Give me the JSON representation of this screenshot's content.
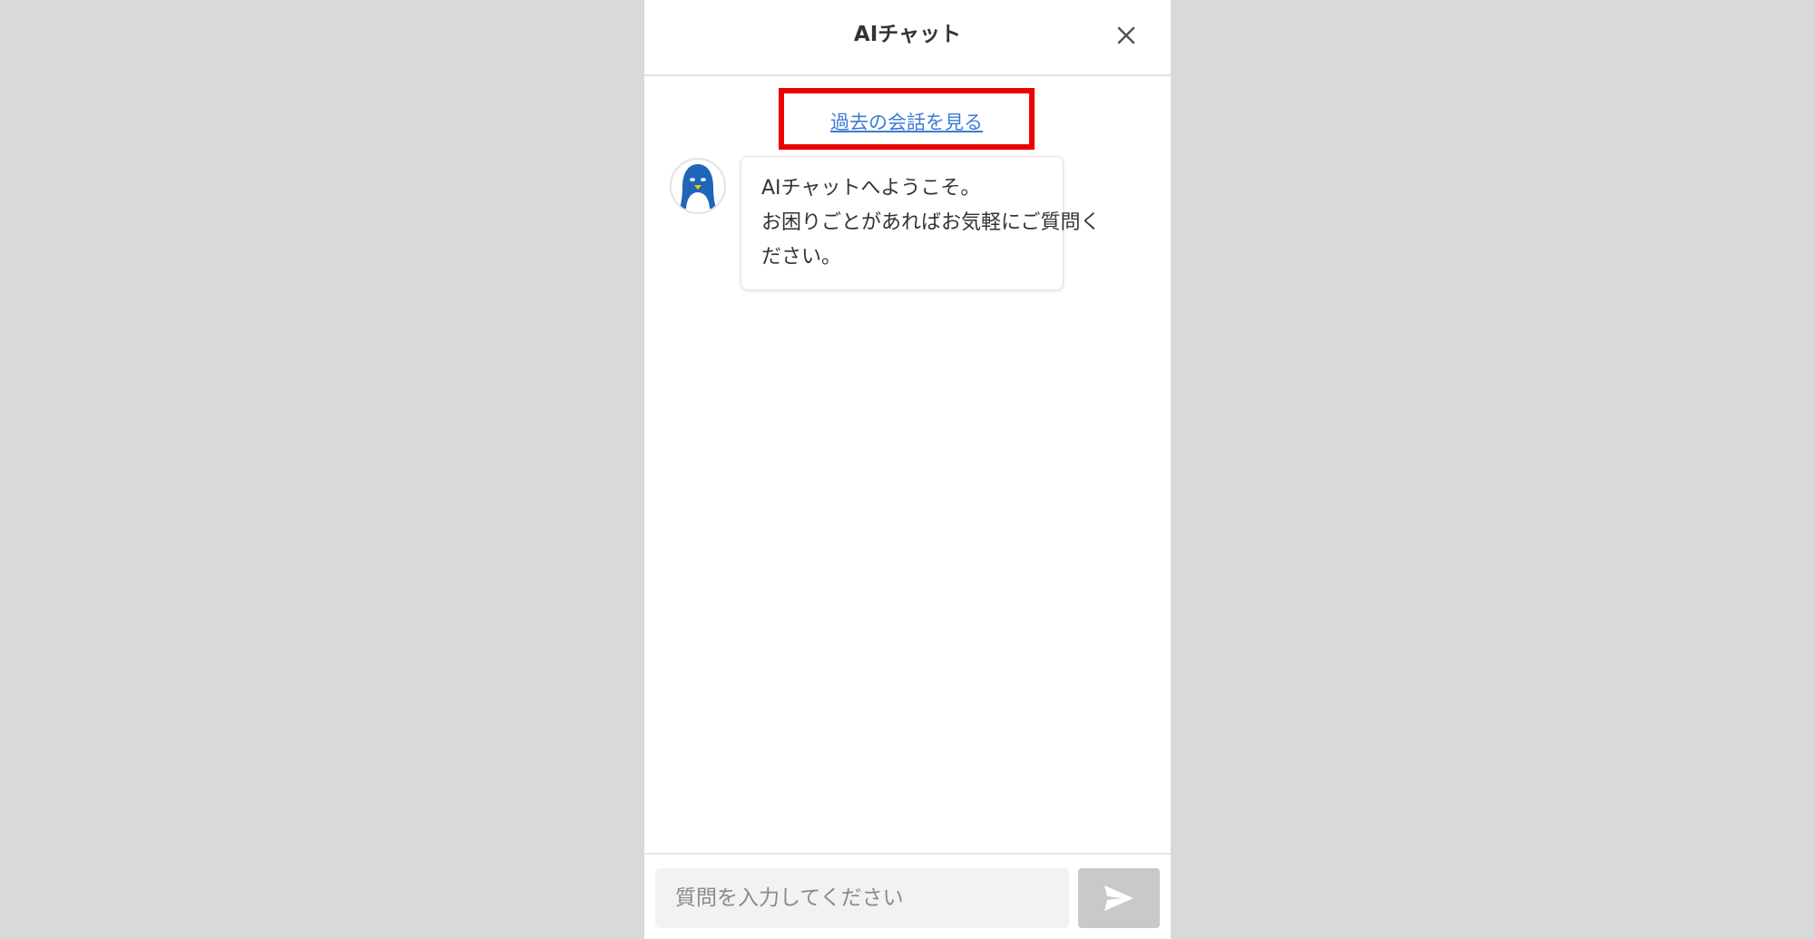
{
  "header": {
    "title": "AIチャット",
    "close_icon": "close-icon"
  },
  "history": {
    "link_label": "過去の会話を見る",
    "highlight_color": "#ee0000"
  },
  "messages": [
    {
      "sender": "bot",
      "avatar_icon": "penguin-avatar-icon",
      "lines": [
        "AIチャットへようこそ。",
        "お困りごとがあればお気軽にご質問く",
        "ださい。"
      ]
    }
  ],
  "composer": {
    "placeholder": "質問を入力してください",
    "value": "",
    "send_icon": "send-icon"
  },
  "colors": {
    "background": "#d9d9d9",
    "panel": "#ffffff",
    "link": "#3c7bd6",
    "send_button": "#c9c9c9",
    "penguin_blue": "#1f66b8"
  }
}
